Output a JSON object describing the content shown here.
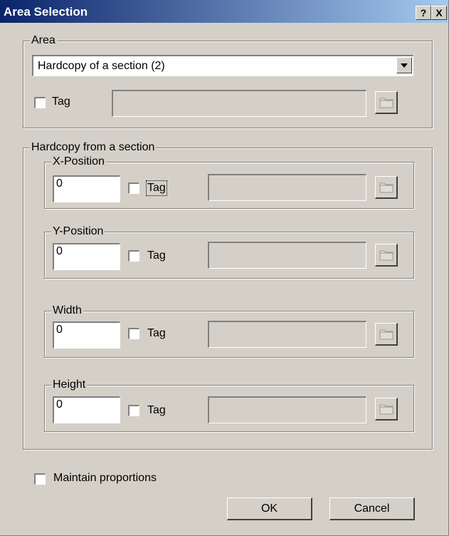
{
  "dialog": {
    "title": "Area Selection",
    "help_label": "?",
    "close_label": "X"
  },
  "area": {
    "legend": "Area",
    "dropdown_value": "Hardcopy of a section (2)",
    "tag_label": "Tag"
  },
  "hardcopy": {
    "legend": "Hardcopy from a section",
    "x": {
      "legend": "X-Position",
      "value": "0",
      "tag_label": "Tag"
    },
    "y": {
      "legend": "Y-Position",
      "value": "0",
      "tag_label": "Tag"
    },
    "width": {
      "legend": "Width",
      "value": "0",
      "tag_label": "Tag"
    },
    "height": {
      "legend": "Height",
      "value": "0",
      "tag_label": "Tag"
    }
  },
  "maintain_label": "Maintain proportions",
  "buttons": {
    "ok": "OK",
    "cancel": "Cancel"
  },
  "icons": {
    "browse": "folder-icon",
    "dropdown": "dropdown-arrow-icon"
  }
}
